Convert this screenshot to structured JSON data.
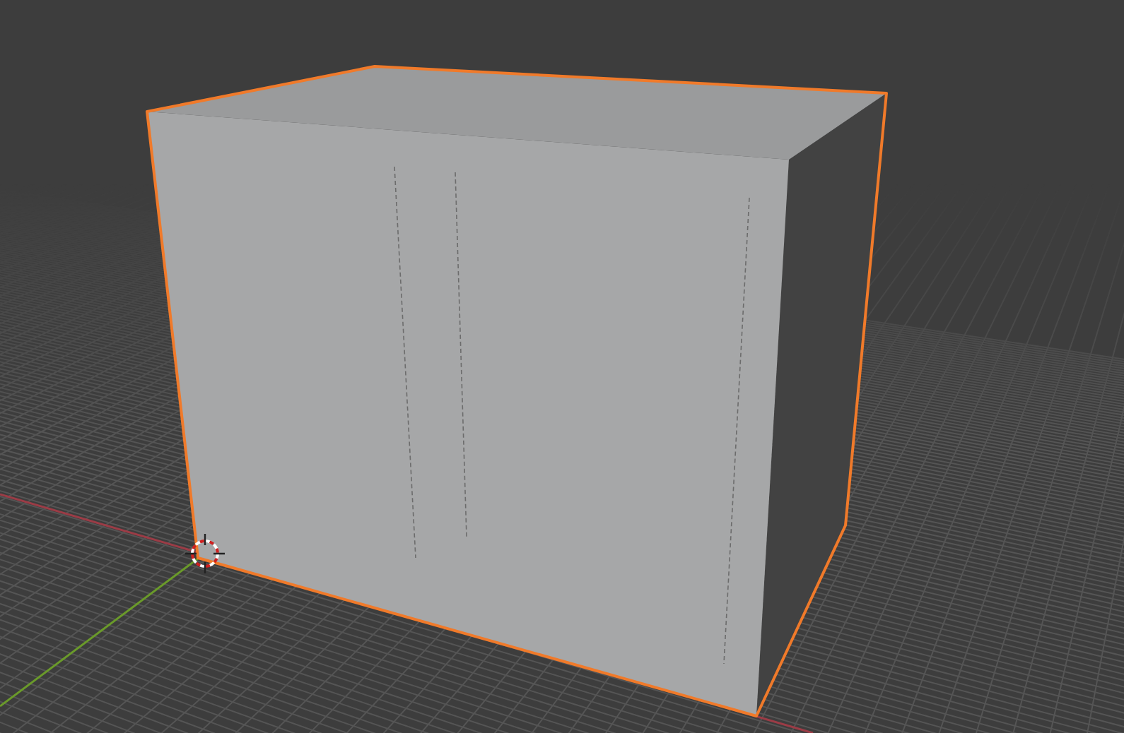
{
  "viewport": {
    "object": {
      "kind": "cube",
      "selected": true
    }
  }
}
